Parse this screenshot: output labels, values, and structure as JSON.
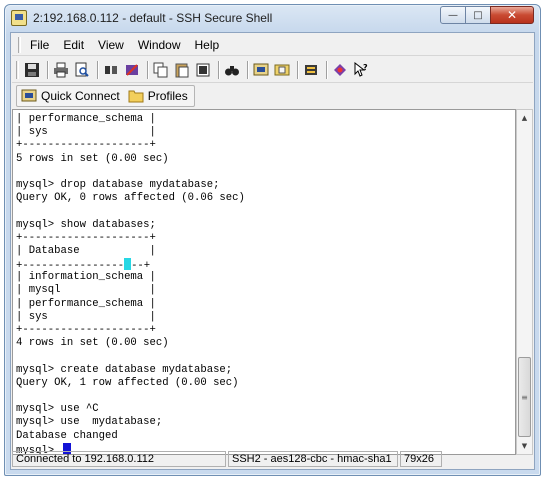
{
  "window": {
    "title": "2:192.168.0.112 - default - SSH Secure Shell",
    "controls": {
      "minimize": "—",
      "maximize": "□",
      "close": "✕"
    }
  },
  "menu": [
    "File",
    "Edit",
    "View",
    "Window",
    "Help"
  ],
  "toolbar_icons": [
    "save-icon",
    "print-icon",
    "print-preview-icon",
    "disconnect-icon",
    "quick-settings-icon",
    "copy-icon",
    "paste-icon",
    "paste-special-icon",
    "find-icon",
    "new-terminal-icon",
    "new-file-transfer-icon",
    "settings-icon",
    "help-icon",
    "context-help-icon"
  ],
  "quickbar": {
    "quick_connect": "Quick Connect",
    "profiles": "Profiles"
  },
  "terminal": {
    "lines": [
      "| performance_schema |",
      "| sys                |",
      "+--------------------+",
      "5 rows in set (0.00 sec)",
      "",
      "mysql> drop database mydatabase;",
      "Query OK, 0 rows affected (0.06 sec)",
      "",
      "mysql> show databases;",
      "+--------------------+",
      "| Database           |",
      "+----------------",
      "| information_schema |",
      "| mysql              |",
      "| performance_schema |",
      "| sys                |",
      "+--------------------+",
      "4 rows in set (0.00 sec)",
      "",
      "mysql> create database mydatabase;",
      "Query OK, 1 row affected (0.00 sec)",
      "",
      "mysql> use ^C",
      "mysql> use  mydatabase;",
      "Database changed",
      "mysql> "
    ],
    "highlight_tail": "--+",
    "colors": {
      "cyan_cursor": "#27d7e4",
      "blue_cursor": "#1313d6"
    }
  },
  "status": {
    "connection": "Connected to 192.168.0.112",
    "encryption": "SSH2 - aes128-cbc - hmac-sha1",
    "position": "79x26"
  }
}
